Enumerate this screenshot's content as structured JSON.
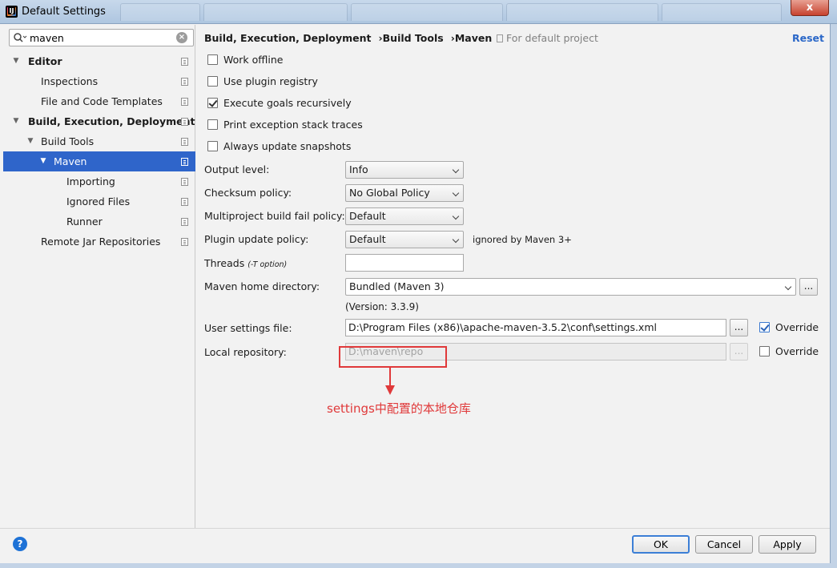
{
  "window": {
    "title": "Default Settings",
    "close_label": "x"
  },
  "sidebar": {
    "search": {
      "value": "maven",
      "placeholder": ""
    },
    "items": [
      {
        "label": "Editor",
        "level": 0,
        "expanded": true,
        "bold": true
      },
      {
        "label": "Inspections",
        "level": 1
      },
      {
        "label": "File and Code Templates",
        "level": 1
      },
      {
        "label": "Build, Execution, Deployment",
        "level": 0,
        "expanded": true,
        "bold": true
      },
      {
        "label": "Build Tools",
        "level": 1,
        "expanded": true
      },
      {
        "label": "Maven",
        "level": 2,
        "expanded": true,
        "selected": true
      },
      {
        "label": "Importing",
        "level": 3
      },
      {
        "label": "Ignored Files",
        "level": 3
      },
      {
        "label": "Runner",
        "level": 3
      },
      {
        "label": "Remote Jar Repositories",
        "level": 1
      }
    ]
  },
  "header": {
    "breadcrumb": [
      "Build, Execution, Deployment",
      "Build Tools",
      "Maven"
    ],
    "separator": "›",
    "scope_note": "For default project",
    "reset_label": "Reset"
  },
  "options": {
    "work_offline": {
      "label": "Work offline",
      "checked": false
    },
    "use_plugin_registry": {
      "label": "Use plugin registry",
      "checked": false
    },
    "execute_goals_recursively": {
      "label": "Execute goals recursively",
      "checked": true
    },
    "print_exception_stack_traces": {
      "label": "Print exception stack traces",
      "checked": false
    },
    "always_update_snapshots": {
      "label": "Always update snapshots",
      "checked": false
    }
  },
  "fields": {
    "output_level": {
      "label": "Output level:",
      "value": "Info"
    },
    "checksum_policy": {
      "label": "Checksum policy:",
      "value": "No Global Policy"
    },
    "multiproject_fail_policy": {
      "label": "Multiproject build fail policy:",
      "value": "Default"
    },
    "plugin_update_policy": {
      "label": "Plugin update policy:",
      "value": "Default",
      "note": "ignored by Maven 3+"
    },
    "threads": {
      "label": "Threads",
      "hint": "(-T option)",
      "value": ""
    },
    "maven_home": {
      "label": "Maven home directory:",
      "value": "Bundled (Maven 3)",
      "version": "(Version: 3.3.9)",
      "browse": "..."
    },
    "user_settings": {
      "label": "User settings file:",
      "value": "D:\\Program Files (x86)\\apache-maven-3.5.2\\conf\\settings.xml",
      "browse": "...",
      "override_label": "Override",
      "override_checked": true
    },
    "local_repository": {
      "label": "Local repository:",
      "value": "D:\\maven\\repo",
      "browse": "...",
      "override_label": "Override",
      "override_checked": false
    }
  },
  "annotation": {
    "text": "settings中配置的本地仓库",
    "color": "#e0393a"
  },
  "footer": {
    "help_label": "?",
    "ok_label": "OK",
    "cancel_label": "Cancel",
    "apply_label": "Apply"
  },
  "colors": {
    "selection": "#2f65ca",
    "link": "#2a67c8"
  }
}
